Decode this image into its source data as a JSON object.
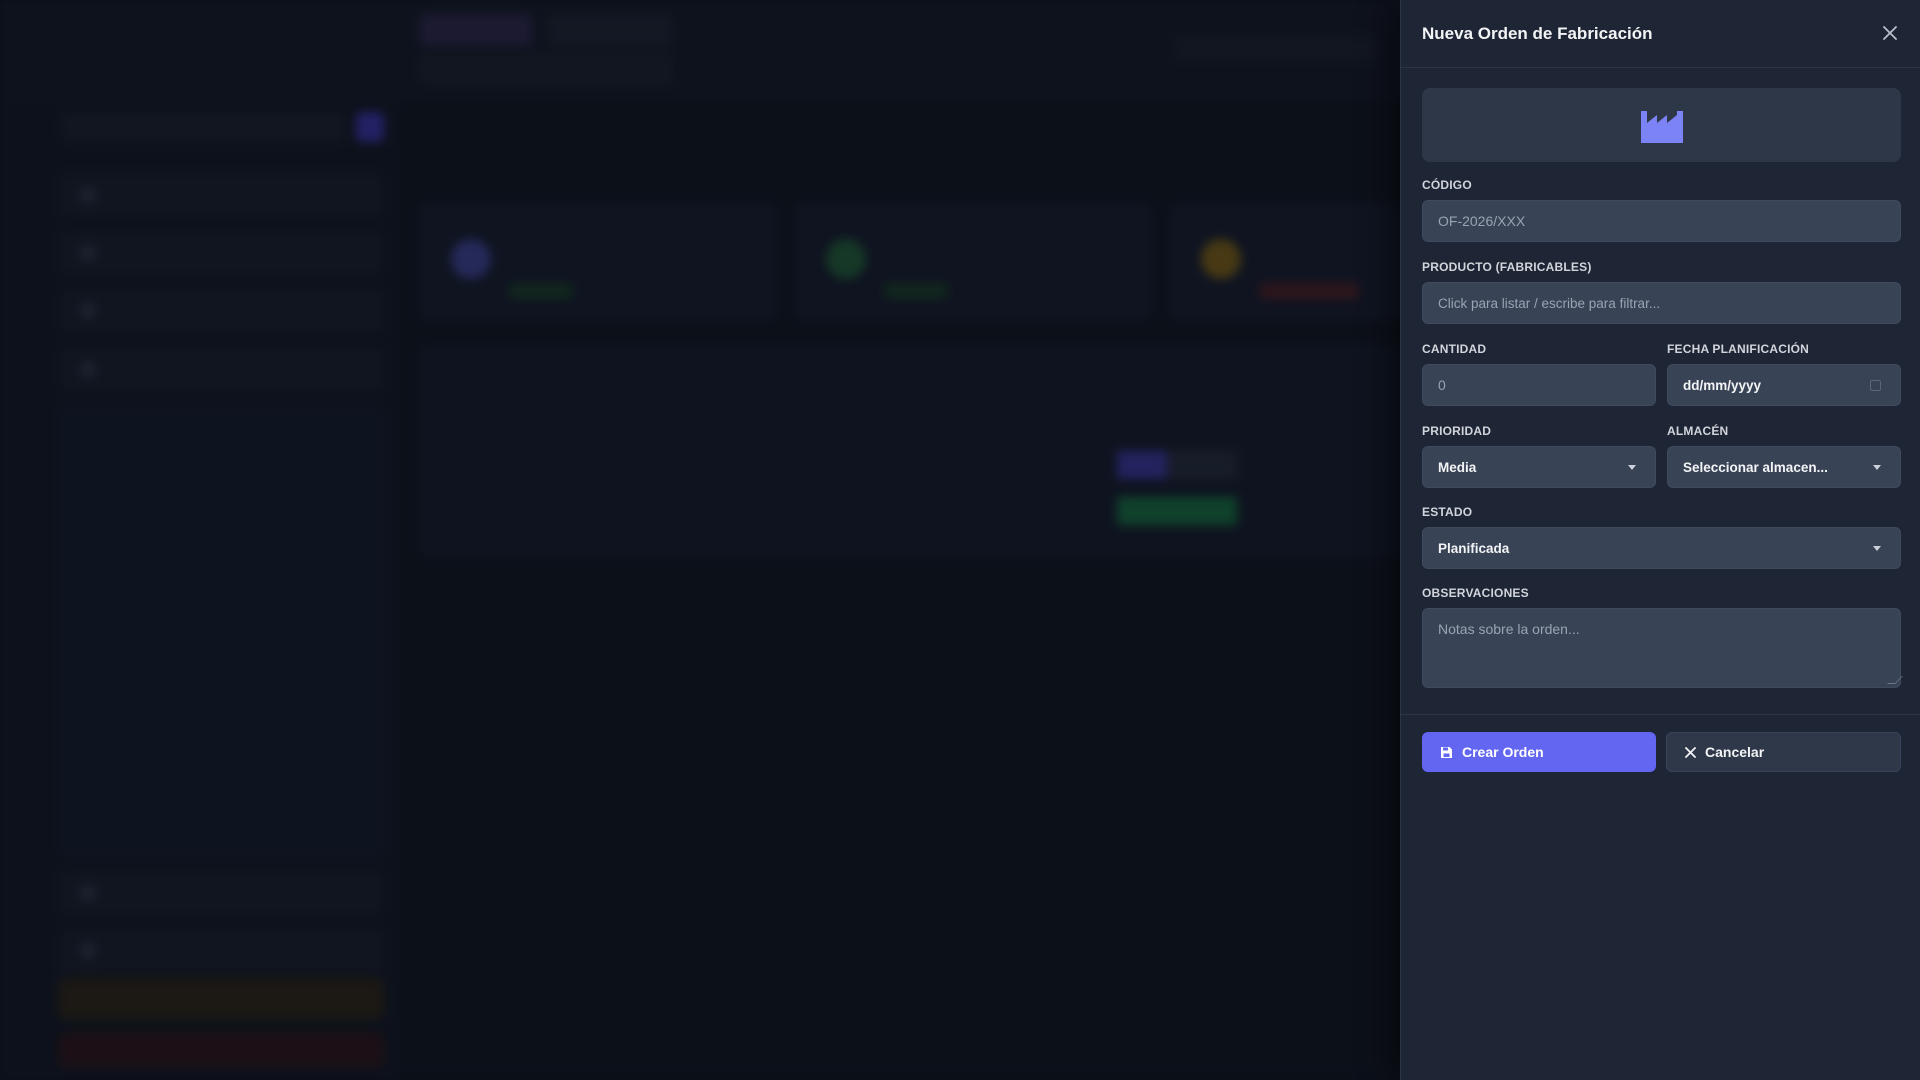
{
  "panel": {
    "title": "Nueva Orden de Fabricación",
    "hero_icon": "factory-icon",
    "fields": {
      "codigo": {
        "label": "CÓDIGO",
        "placeholder": "OF-2026/XXX"
      },
      "producto": {
        "label": "PRODUCTO (FABRICABLES)",
        "placeholder": "Click para listar / escribe para filtrar..."
      },
      "cantidad": {
        "label": "CANTIDAD",
        "placeholder": "0"
      },
      "fecha": {
        "label": "FECHA PLANIFICACIÓN",
        "value": "dd/mm/yyyy"
      },
      "prioridad": {
        "label": "PRIORIDAD",
        "value": "Media"
      },
      "almacen": {
        "label": "ALMACÉN",
        "value": "Seleccionar almacen..."
      },
      "estado": {
        "label": "ESTADO",
        "value": "Planificada"
      },
      "observaciones": {
        "label": "OBSERVACIONES",
        "placeholder": "Notas sobre la orden..."
      }
    },
    "buttons": {
      "create": "Crear Orden",
      "cancel": "Cancelar"
    }
  },
  "colors": {
    "accent": "#6366f1",
    "panel_bg": "#1e2535",
    "field_bg": "#394356"
  }
}
